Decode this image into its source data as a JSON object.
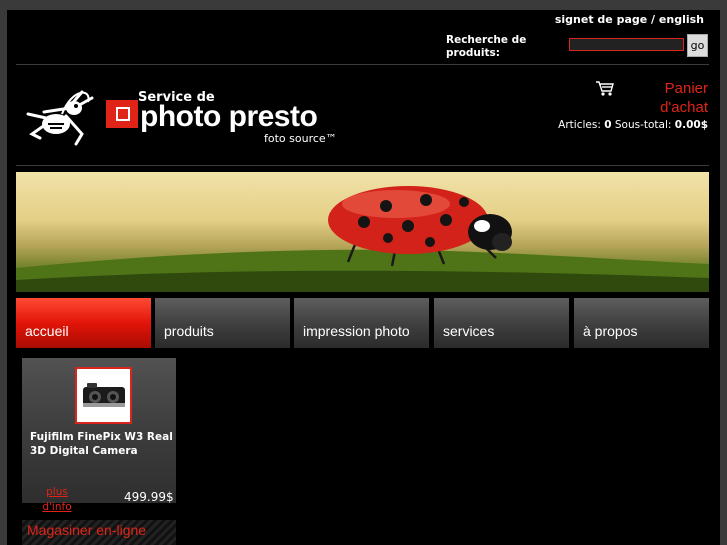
{
  "header": {
    "bookmark_link": "signet de page",
    "separator": " / ",
    "language_link": "english",
    "search_label": "Recherche de produits:",
    "search_value": "",
    "search_button": "go"
  },
  "logo": {
    "service_text": "Service de",
    "brand_text": "photo presto",
    "sub_text": "foto source™"
  },
  "cart": {
    "title": "Panier d'achat",
    "articles_label": "Articles:",
    "articles_value": "0",
    "subtotal_label": "Sous-total:",
    "subtotal_value": "0.00$"
  },
  "nav": {
    "items": [
      {
        "label": "accueil",
        "active": true
      },
      {
        "label": "produits"
      },
      {
        "label": "impression photo"
      },
      {
        "label": "services"
      },
      {
        "label": "à propos"
      }
    ]
  },
  "product": {
    "name": "Fujifilm FinePix W3 Real 3D Digital Camera",
    "more_info": "plus d'info",
    "price": "499.99$"
  },
  "footer": {
    "shop_online": "Magasiner en-ligne"
  },
  "colors": {
    "accent": "#e02418",
    "page_bg": "#000000",
    "outer_bg": "#3a3a3a"
  },
  "icons": {
    "cart": "shopping-cart-icon",
    "mascot": "bee-mascot-icon",
    "camera": "camera-product-icon"
  }
}
